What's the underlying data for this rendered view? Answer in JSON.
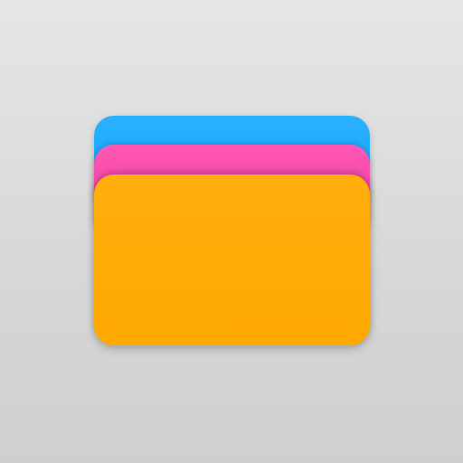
{
  "app_icon": {
    "name": "wallet-cards-icon",
    "colors": {
      "background": "#d9d9d9",
      "back_card": "#19a7fb",
      "middle_card": "#f74aa8",
      "front_card": "#ffab05"
    }
  }
}
